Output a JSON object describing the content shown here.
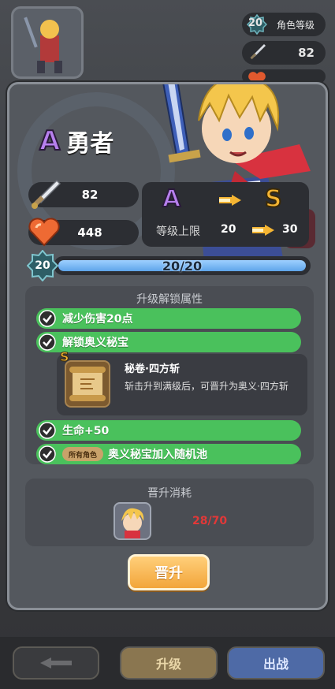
{
  "background": {
    "level_label": "角色等级",
    "level_value": "20",
    "attack_value": "82",
    "hp_value": "448"
  },
  "hero": {
    "rank": "A",
    "name": "勇者",
    "attack": "82",
    "hp": "448"
  },
  "rank_up": {
    "from_rank": "A",
    "to_rank": "S",
    "level_cap_label": "等级上限",
    "level_cap_from": "20",
    "level_cap_to": "30"
  },
  "experience": {
    "level": "20",
    "text": "20/20",
    "fill_fraction": 1.0
  },
  "unlocks": {
    "title": "升级解锁属性",
    "items": [
      {
        "text": "减少伤害20点"
      },
      {
        "text": "解锁奥义秘宝"
      },
      {
        "text": "生命+50"
      },
      {
        "tag": "所有角色",
        "text": "奥义秘宝加入随机池"
      }
    ],
    "relic": {
      "rank": "S",
      "name": "秘卷·四方斩",
      "description": "斩击升到满级后，可晋升为奥义·四方斩"
    }
  },
  "cost": {
    "title": "晋升消耗",
    "count": "28/70"
  },
  "promote_button": "晋升",
  "bottom_bar": {
    "upgrade": "升级",
    "deploy": "出战"
  },
  "colors": {
    "rank_a": "#b780ee",
    "rank_s": "#f5b533",
    "check_green": "#4ac15c",
    "cost_red": "#e23838",
    "xp_blue": "#5ea4ea",
    "button_orange": "#f2a53a"
  }
}
